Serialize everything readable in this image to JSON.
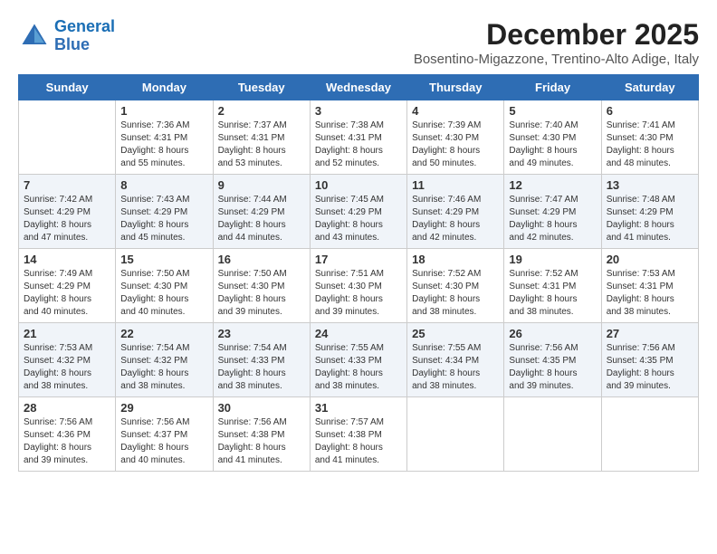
{
  "header": {
    "logo_line1": "General",
    "logo_line2": "Blue",
    "main_title": "December 2025",
    "subtitle": "Bosentino-Migazzone, Trentino-Alto Adige, Italy"
  },
  "days_of_week": [
    "Sunday",
    "Monday",
    "Tuesday",
    "Wednesday",
    "Thursday",
    "Friday",
    "Saturday"
  ],
  "weeks": [
    [
      {
        "day": "",
        "info": ""
      },
      {
        "day": "1",
        "info": "Sunrise: 7:36 AM\nSunset: 4:31 PM\nDaylight: 8 hours\nand 55 minutes."
      },
      {
        "day": "2",
        "info": "Sunrise: 7:37 AM\nSunset: 4:31 PM\nDaylight: 8 hours\nand 53 minutes."
      },
      {
        "day": "3",
        "info": "Sunrise: 7:38 AM\nSunset: 4:31 PM\nDaylight: 8 hours\nand 52 minutes."
      },
      {
        "day": "4",
        "info": "Sunrise: 7:39 AM\nSunset: 4:30 PM\nDaylight: 8 hours\nand 50 minutes."
      },
      {
        "day": "5",
        "info": "Sunrise: 7:40 AM\nSunset: 4:30 PM\nDaylight: 8 hours\nand 49 minutes."
      },
      {
        "day": "6",
        "info": "Sunrise: 7:41 AM\nSunset: 4:30 PM\nDaylight: 8 hours\nand 48 minutes."
      }
    ],
    [
      {
        "day": "7",
        "info": "Sunrise: 7:42 AM\nSunset: 4:29 PM\nDaylight: 8 hours\nand 47 minutes."
      },
      {
        "day": "8",
        "info": "Sunrise: 7:43 AM\nSunset: 4:29 PM\nDaylight: 8 hours\nand 45 minutes."
      },
      {
        "day": "9",
        "info": "Sunrise: 7:44 AM\nSunset: 4:29 PM\nDaylight: 8 hours\nand 44 minutes."
      },
      {
        "day": "10",
        "info": "Sunrise: 7:45 AM\nSunset: 4:29 PM\nDaylight: 8 hours\nand 43 minutes."
      },
      {
        "day": "11",
        "info": "Sunrise: 7:46 AM\nSunset: 4:29 PM\nDaylight: 8 hours\nand 42 minutes."
      },
      {
        "day": "12",
        "info": "Sunrise: 7:47 AM\nSunset: 4:29 PM\nDaylight: 8 hours\nand 42 minutes."
      },
      {
        "day": "13",
        "info": "Sunrise: 7:48 AM\nSunset: 4:29 PM\nDaylight: 8 hours\nand 41 minutes."
      }
    ],
    [
      {
        "day": "14",
        "info": "Sunrise: 7:49 AM\nSunset: 4:29 PM\nDaylight: 8 hours\nand 40 minutes."
      },
      {
        "day": "15",
        "info": "Sunrise: 7:50 AM\nSunset: 4:30 PM\nDaylight: 8 hours\nand 40 minutes."
      },
      {
        "day": "16",
        "info": "Sunrise: 7:50 AM\nSunset: 4:30 PM\nDaylight: 8 hours\nand 39 minutes."
      },
      {
        "day": "17",
        "info": "Sunrise: 7:51 AM\nSunset: 4:30 PM\nDaylight: 8 hours\nand 39 minutes."
      },
      {
        "day": "18",
        "info": "Sunrise: 7:52 AM\nSunset: 4:30 PM\nDaylight: 8 hours\nand 38 minutes."
      },
      {
        "day": "19",
        "info": "Sunrise: 7:52 AM\nSunset: 4:31 PM\nDaylight: 8 hours\nand 38 minutes."
      },
      {
        "day": "20",
        "info": "Sunrise: 7:53 AM\nSunset: 4:31 PM\nDaylight: 8 hours\nand 38 minutes."
      }
    ],
    [
      {
        "day": "21",
        "info": "Sunrise: 7:53 AM\nSunset: 4:32 PM\nDaylight: 8 hours\nand 38 minutes."
      },
      {
        "day": "22",
        "info": "Sunrise: 7:54 AM\nSunset: 4:32 PM\nDaylight: 8 hours\nand 38 minutes."
      },
      {
        "day": "23",
        "info": "Sunrise: 7:54 AM\nSunset: 4:33 PM\nDaylight: 8 hours\nand 38 minutes."
      },
      {
        "day": "24",
        "info": "Sunrise: 7:55 AM\nSunset: 4:33 PM\nDaylight: 8 hours\nand 38 minutes."
      },
      {
        "day": "25",
        "info": "Sunrise: 7:55 AM\nSunset: 4:34 PM\nDaylight: 8 hours\nand 38 minutes."
      },
      {
        "day": "26",
        "info": "Sunrise: 7:56 AM\nSunset: 4:35 PM\nDaylight: 8 hours\nand 39 minutes."
      },
      {
        "day": "27",
        "info": "Sunrise: 7:56 AM\nSunset: 4:35 PM\nDaylight: 8 hours\nand 39 minutes."
      }
    ],
    [
      {
        "day": "28",
        "info": "Sunrise: 7:56 AM\nSunset: 4:36 PM\nDaylight: 8 hours\nand 39 minutes."
      },
      {
        "day": "29",
        "info": "Sunrise: 7:56 AM\nSunset: 4:37 PM\nDaylight: 8 hours\nand 40 minutes."
      },
      {
        "day": "30",
        "info": "Sunrise: 7:56 AM\nSunset: 4:38 PM\nDaylight: 8 hours\nand 41 minutes."
      },
      {
        "day": "31",
        "info": "Sunrise: 7:57 AM\nSunset: 4:38 PM\nDaylight: 8 hours\nand 41 minutes."
      },
      {
        "day": "",
        "info": ""
      },
      {
        "day": "",
        "info": ""
      },
      {
        "day": "",
        "info": ""
      }
    ]
  ]
}
